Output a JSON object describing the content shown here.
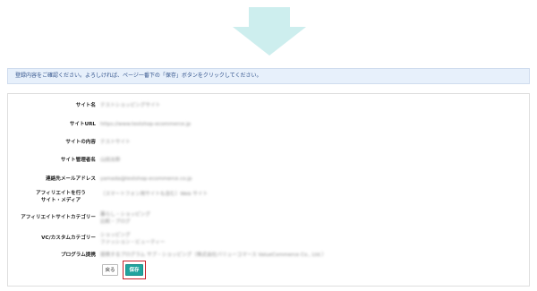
{
  "notice_text": "登録内容をご確認ください。よろしければ、ページ一番下の「保存」ボタンをクリックしてください。",
  "colors": {
    "arrow": "#cdeeee",
    "notice_bg": "#e7f0fb",
    "save_button": "#21a39e",
    "highlight": "#c8202c"
  },
  "form": {
    "rows": [
      {
        "label": "サイト名",
        "value": "テストショッピングサイト"
      },
      {
        "label": "サイトURL",
        "value": "https://www.testshop-ecommerce.jp"
      },
      {
        "label": "サイトの内容",
        "value": "テストサイト"
      },
      {
        "label": "サイト管理者名",
        "value": "山田太郎"
      },
      {
        "label": "連絡先メールアドレス",
        "value": "yamada@testshop-ecommerce.co.jp"
      },
      {
        "label": "アフィリエイトを行う\nサイト・メディア",
        "value": "（スマートフォン用サイトも含む）Web サイト"
      },
      {
        "label": "アフィリエイトサイトカテゴリー",
        "value": "暮らし・ショッピング\n比較・ブログ"
      },
      {
        "label": "VC/カスタムカテゴリー",
        "value": "ショッピング\nファッション・ビューティー"
      },
      {
        "label": "プログラム提携",
        "value": "提携するプログラム サブ・ショッピング（株式会社バリューコマース ValueCommerce Co., Ltd.）"
      }
    ]
  },
  "buttons": {
    "back": "戻る",
    "save": "保存"
  }
}
